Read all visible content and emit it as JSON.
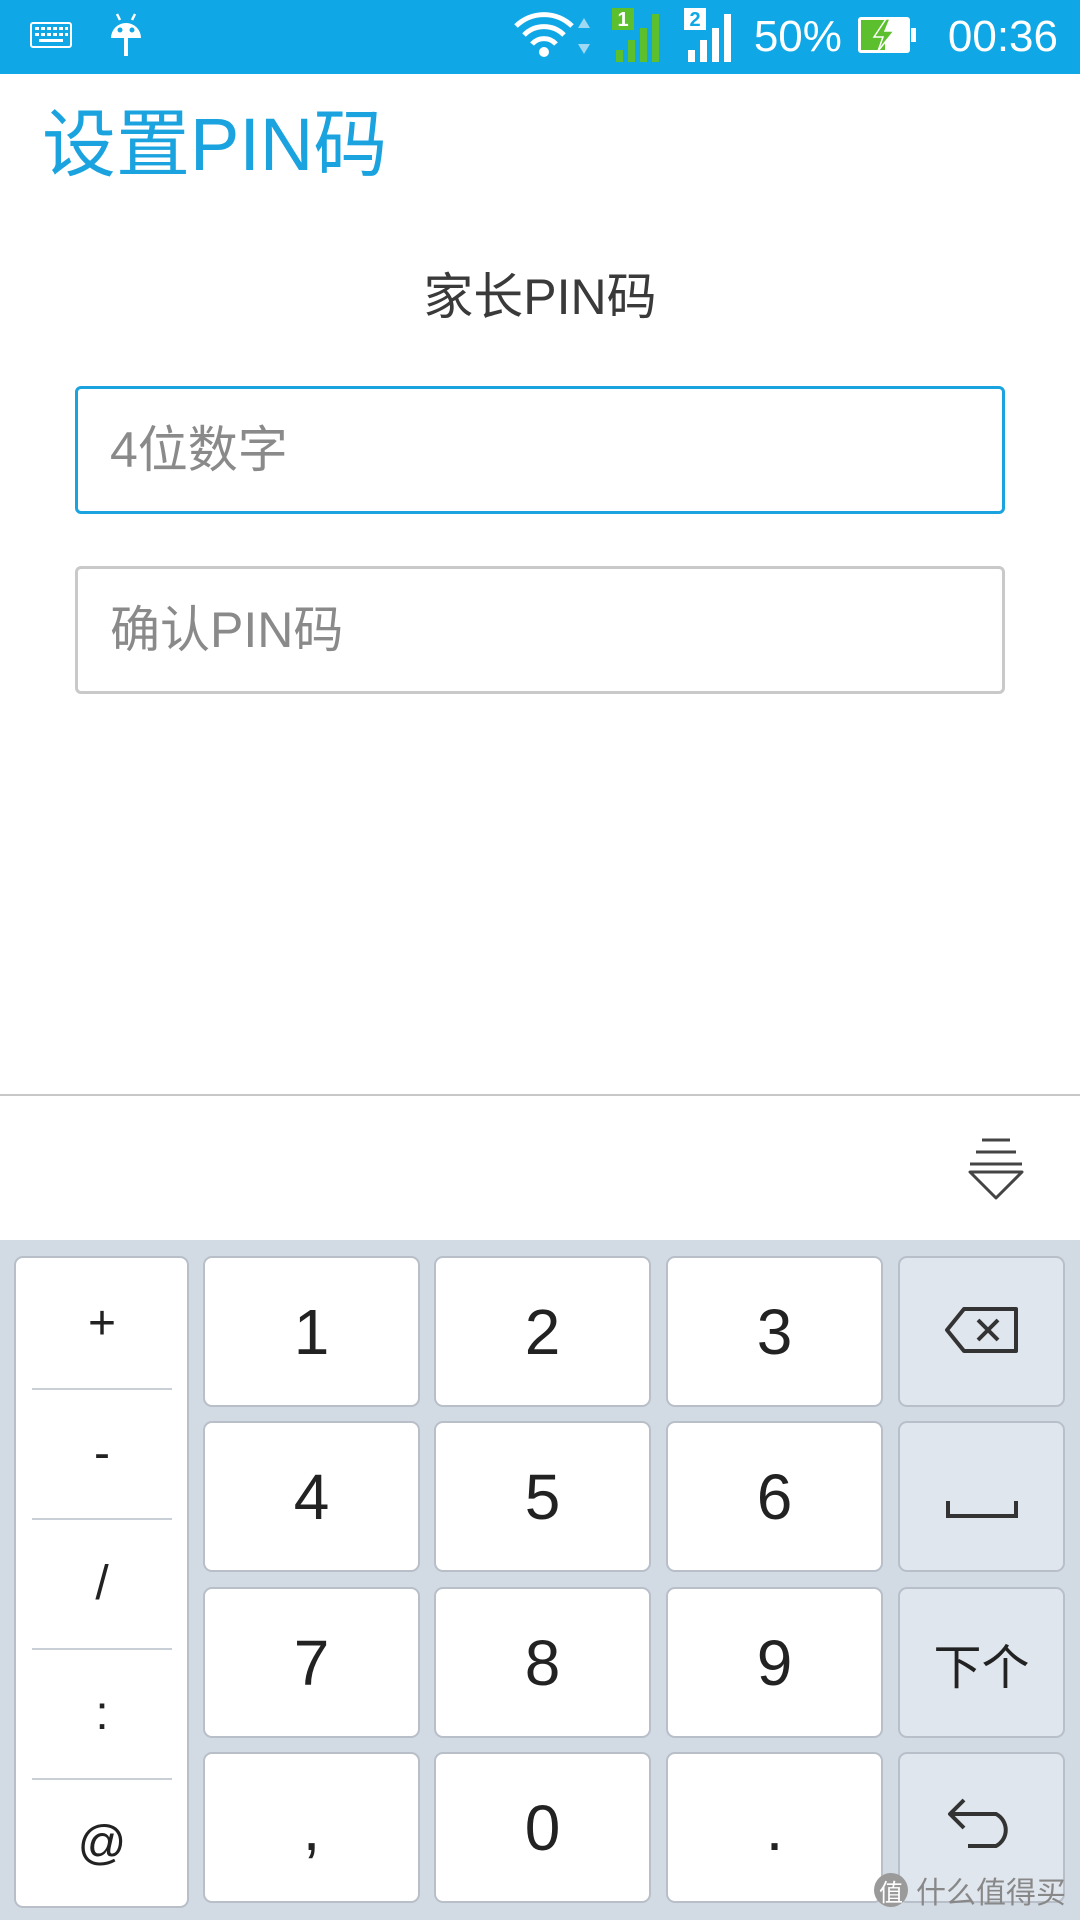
{
  "status_bar": {
    "battery": "50%",
    "time": "00:36",
    "sim1": "1",
    "sim2": "2",
    "icons": [
      "keyboard-icon",
      "android-icon",
      "wifi-icon",
      "signal-icon",
      "battery-charging-icon"
    ]
  },
  "page": {
    "title": "设置PIN码",
    "heading": "家长PIN码"
  },
  "form": {
    "pin_placeholder": "4位数字",
    "confirm_placeholder": "确认PIN码"
  },
  "keyboard": {
    "symbols": [
      "+",
      "-",
      "/",
      ":",
      "@"
    ],
    "keys": [
      "1",
      "2",
      "3",
      "4",
      "5",
      "6",
      "7",
      "8",
      "9",
      ",",
      "0",
      "."
    ],
    "next_label": "下个",
    "icons": [
      "backspace-icon",
      "space-icon",
      "enter-icon",
      "hide-keyboard-icon"
    ]
  },
  "watermark": {
    "badge": "值",
    "text": "什么值得买"
  },
  "colors": {
    "accent": "#1aa3df",
    "status_bar": "#0fa7e6",
    "keyboard_bg": "#d2dae4"
  }
}
